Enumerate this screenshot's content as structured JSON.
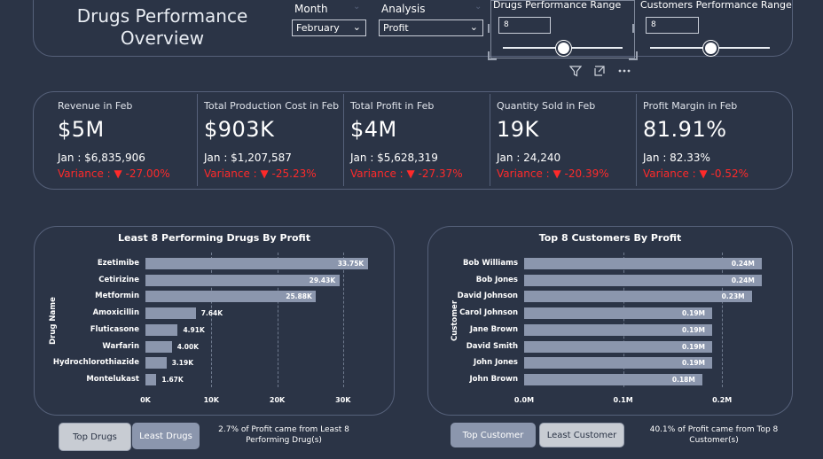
{
  "header": {
    "title_line1": "Drugs Performance",
    "title_line2": "Overview",
    "month_label": "Month",
    "month_value": "February",
    "analysis_label": "Analysis",
    "analysis_value": "Profit",
    "drugs_range_label": "Drugs Performance Range",
    "drugs_range_value": "8",
    "drugs_range_level": 0.5,
    "customers_range_label": "Customers Performance Range",
    "customers_range_value": "8",
    "customers_range_level": 0.5,
    "toolbar_icons": [
      "filter-icon",
      "focus-mode-icon",
      "more-options-icon"
    ]
  },
  "kpis": [
    {
      "title": "Revenue in Feb",
      "value": "$5M",
      "prev": "Jan : $6,835,906",
      "variance": "Variance : ▼ -27.00%"
    },
    {
      "title": "Total Production Cost in Feb",
      "value": "$903K",
      "prev": "Jan : $1,207,587",
      "variance": "Variance : ▼ -25.23%"
    },
    {
      "title": "Total Profit in Feb",
      "value": "$4M",
      "prev": "Jan : $5,628,319",
      "variance": "Variance : ▼ -27.37%"
    },
    {
      "title": "Quantity Sold in Feb",
      "value": "19K",
      "prev": "Jan : 24,240",
      "variance": "Variance : ▼ -20.39%"
    },
    {
      "title": "Profit Margin in Feb",
      "value": "81.91%",
      "prev": "Jan : 82.33%",
      "variance": "Variance : ▼ -0.52%"
    }
  ],
  "colors": {
    "background": "#2b3446",
    "bar": "#8b96ad",
    "variance": "#ff2a2a",
    "panel_border": "#56617a"
  },
  "chart_data": [
    {
      "type": "bar",
      "orientation": "horizontal",
      "title": "Least 8 Performing Drugs By Profit",
      "ylabel": "Drug Name",
      "categories": [
        "Ezetimibe",
        "Cetirizine",
        "Metformin",
        "Amoxicillin",
        "Fluticasone",
        "Warfarin",
        "Hydrochlorothiazide",
        "Montelukast"
      ],
      "values": [
        33750,
        29430,
        25880,
        7640,
        4910,
        4000,
        3190,
        1670
      ],
      "data_labels": [
        "33.75K",
        "29.43K",
        "25.88K",
        "7.64K",
        "4.91K",
        "4.00K",
        "3.19K",
        "1.67K"
      ],
      "xlim": [
        0,
        35000
      ],
      "xticks": [
        0,
        10000,
        20000,
        30000
      ],
      "xtick_labels": [
        "0K",
        "10K",
        "20K",
        "30K"
      ],
      "grid": true
    },
    {
      "type": "bar",
      "orientation": "horizontal",
      "title": "Top 8 Customers By Profit",
      "ylabel": "Customer",
      "categories": [
        "Bob Williams",
        "Bob Jones",
        "David Johnson",
        "Carol Johnson",
        "Jane Brown",
        "David Smith",
        "John Jones",
        "John Brown"
      ],
      "values": [
        0.24,
        0.24,
        0.23,
        0.19,
        0.19,
        0.19,
        0.19,
        0.18
      ],
      "data_labels": [
        "0.24M",
        "0.24M",
        "0.23M",
        "0.19M",
        "0.19M",
        "0.19M",
        "0.19M",
        "0.18M"
      ],
      "xlim": [
        0,
        0.25
      ],
      "xticks": [
        0,
        0.1,
        0.2
      ],
      "xtick_labels": [
        "0.0M",
        "0.1M",
        "0.2M"
      ],
      "grid": true
    }
  ],
  "footer": {
    "top_drugs_button": "Top Drugs",
    "least_drugs_button": "Least Drugs",
    "drugs_note": "2.7% of Profit came from Least 8 Performing Drug(s)",
    "top_customer_button": "Top Customer",
    "least_customer_button": "Least Customer",
    "customers_note": "40.1% of Profit came from Top 8 Customer(s)"
  }
}
